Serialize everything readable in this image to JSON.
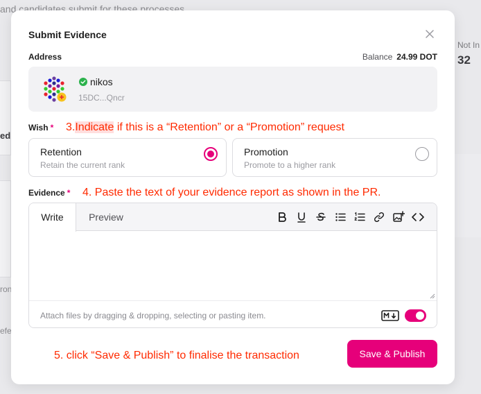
{
  "background": {
    "top_text": "and candidates submit for these processes",
    "side_label_1": "ed",
    "side_label_2": "ron",
    "side_label_3": "efe",
    "right_label": "Not In",
    "right_value": "32"
  },
  "modal": {
    "title": "Submit Evidence",
    "address_label": "Address",
    "balance_label": "Balance",
    "balance_value": "24.99 DOT",
    "account": {
      "name": "nikos",
      "address_short": "15DC...Qncr",
      "verified_icon": "check-circle-icon"
    },
    "wish": {
      "label": "Wish",
      "required_mark": "*",
      "options": [
        {
          "title": "Retention",
          "subtitle": "Retain the current rank",
          "selected": true
        },
        {
          "title": "Promotion",
          "subtitle": "Promote to a higher rank",
          "selected": false
        }
      ]
    },
    "evidence": {
      "label": "Evidence",
      "required_mark": "*",
      "tabs": [
        "Write",
        "Preview"
      ],
      "active_tab": "Write",
      "toolbar_icons": [
        "bold-icon",
        "underline-icon",
        "strikethrough-icon",
        "bullet-list-icon",
        "numbered-list-icon",
        "link-icon",
        "image-icon",
        "code-icon"
      ],
      "text_value": "",
      "attach_hint": "Attach files by dragging & dropping, selecting or pasting item.",
      "markdown_enabled": true
    },
    "publish_label": "Save & Publish"
  },
  "annotations": {
    "step3_prefix": "3.",
    "step3_highlight": "Indicate",
    "step3_rest": " if this is a “Retention” or a “Promotion” request",
    "step4": "4. Paste the text of your evidence report as shown in the PR.",
    "step5": "5. click “Save & Publish” to finalise  the transaction"
  },
  "colors": {
    "accent": "#e6007a",
    "annotation": "#ff2a00",
    "verified": "#2bb24c"
  }
}
